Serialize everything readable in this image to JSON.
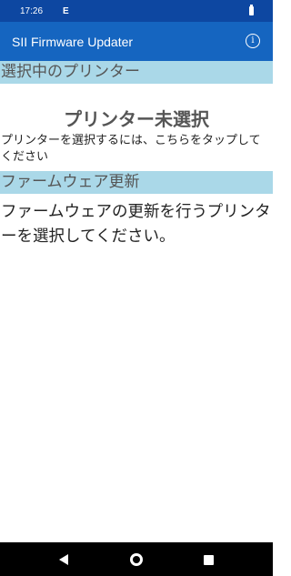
{
  "status_bar": {
    "time": "17:26",
    "sim_indicator": "E"
  },
  "app_bar": {
    "title": "SII Firmware Updater",
    "info_icon": "info-icon",
    "info_glyph": "i"
  },
  "printer_section": {
    "header": "選択中のプリンター",
    "status": "プリンター未選択",
    "hint": "プリンターを選択するには、こちらをタップしてください"
  },
  "firmware_section": {
    "header": "ファームウェア更新",
    "hint": "ファームウェアの更新を行うプリンターを選択してください。"
  },
  "nav_bar": {
    "back_icon": "back-icon",
    "home_icon": "home-icon",
    "recent_icon": "recent-apps-icon"
  },
  "colors": {
    "status_bar": "#0d47a1",
    "app_bar": "#1565c0",
    "section_header": "#aad8e8",
    "nav_bar": "#000000"
  }
}
